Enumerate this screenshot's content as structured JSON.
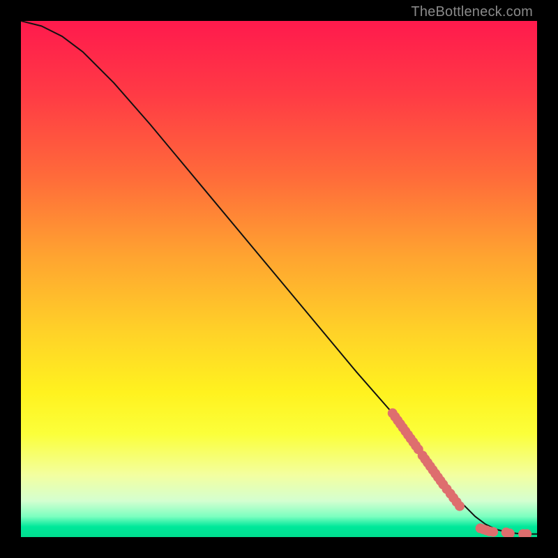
{
  "watermark": "TheBottleneck.com",
  "chart_data": {
    "type": "line",
    "title": "",
    "xlabel": "",
    "ylabel": "",
    "xlim": [
      0,
      100
    ],
    "ylim": [
      0,
      100
    ],
    "grid": false,
    "series": [
      {
        "name": "curve",
        "x": [
          0,
          4,
          8,
          12,
          18,
          25,
          35,
          45,
          55,
          65,
          72,
          78,
          82,
          85,
          88,
          90,
          92,
          94,
          96,
          98,
          100
        ],
        "y": [
          100,
          99,
          97,
          94,
          88,
          80,
          68,
          56,
          44,
          32,
          24,
          16,
          11,
          7,
          4,
          2.5,
          1.5,
          1,
          0.7,
          0.6,
          0.6
        ]
      }
    ],
    "markers": [
      {
        "x": 72.0,
        "y": 24.0
      },
      {
        "x": 72.5,
        "y": 23.3
      },
      {
        "x": 73.0,
        "y": 22.6
      },
      {
        "x": 73.5,
        "y": 21.9
      },
      {
        "x": 74.0,
        "y": 21.2
      },
      {
        "x": 74.5,
        "y": 20.5
      },
      {
        "x": 75.0,
        "y": 19.8
      },
      {
        "x": 75.5,
        "y": 19.1
      },
      {
        "x": 76.0,
        "y": 18.4
      },
      {
        "x": 76.5,
        "y": 17.7
      },
      {
        "x": 77.0,
        "y": 17.0
      },
      {
        "x": 77.8,
        "y": 15.8
      },
      {
        "x": 78.3,
        "y": 15.1
      },
      {
        "x": 78.8,
        "y": 14.4
      },
      {
        "x": 79.3,
        "y": 13.7
      },
      {
        "x": 79.8,
        "y": 13.0
      },
      {
        "x": 80.3,
        "y": 12.3
      },
      {
        "x": 80.8,
        "y": 11.6
      },
      {
        "x": 81.3,
        "y": 10.9
      },
      {
        "x": 81.8,
        "y": 10.2
      },
      {
        "x": 82.5,
        "y": 9.3
      },
      {
        "x": 83.2,
        "y": 8.4
      },
      {
        "x": 83.8,
        "y": 7.6
      },
      {
        "x": 84.4,
        "y": 6.8
      },
      {
        "x": 85.0,
        "y": 6.0
      },
      {
        "x": 89.0,
        "y": 1.7
      },
      {
        "x": 89.6,
        "y": 1.5
      },
      {
        "x": 90.2,
        "y": 1.3
      },
      {
        "x": 90.8,
        "y": 1.1
      },
      {
        "x": 91.5,
        "y": 1.0
      },
      {
        "x": 94.0,
        "y": 0.9
      },
      {
        "x": 94.7,
        "y": 0.7
      },
      {
        "x": 97.3,
        "y": 0.6
      },
      {
        "x": 98.0,
        "y": 0.6
      }
    ],
    "marker_style": {
      "color": "#de6e6e",
      "radius_px": 7
    }
  }
}
